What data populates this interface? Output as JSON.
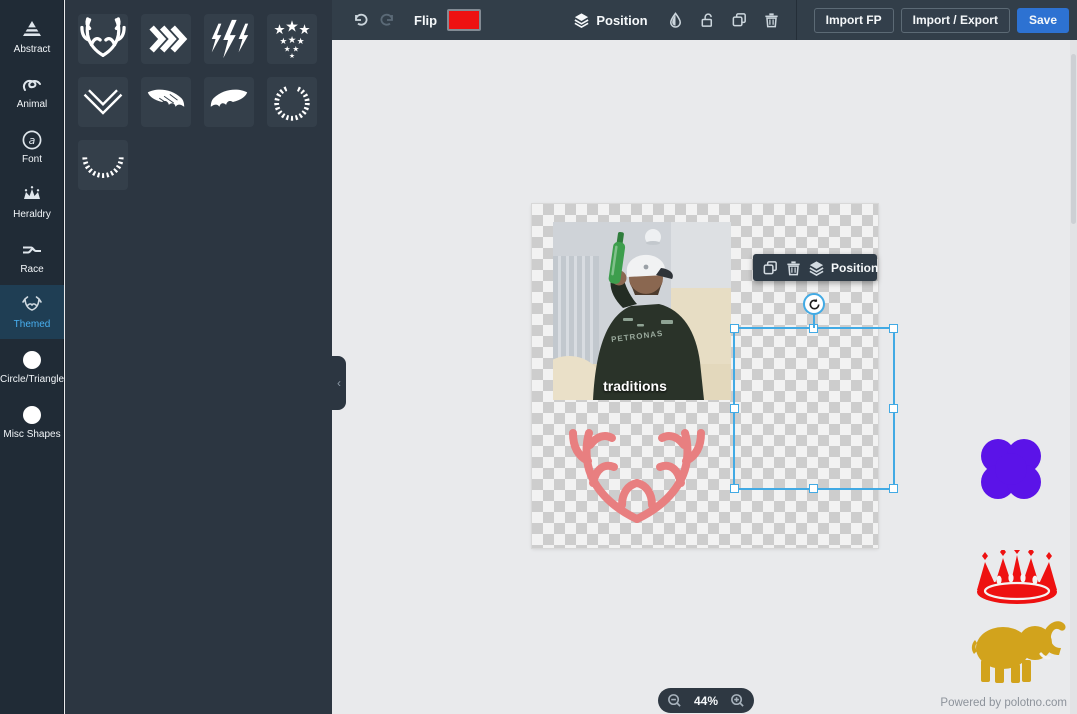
{
  "sidebar": {
    "items": [
      {
        "label": "Abstract",
        "icon": "abstract-icon",
        "active": false
      },
      {
        "label": "Animal",
        "icon": "animal-icon",
        "active": false
      },
      {
        "label": "Font",
        "icon": "font-icon",
        "active": false
      },
      {
        "label": "Heraldry",
        "icon": "heraldry-icon",
        "active": false
      },
      {
        "label": "Race",
        "icon": "race-icon",
        "active": false
      },
      {
        "label": "Themed",
        "icon": "antlers-icon",
        "active": true
      },
      {
        "label": "Circle/Triangle",
        "icon": "circle-icon",
        "active": false
      },
      {
        "label": "Misc Shapes",
        "icon": "circle-icon",
        "active": false
      }
    ]
  },
  "shapes_panel": {
    "tiles": [
      "antlers",
      "triple-chevron-right",
      "lightning-bolts",
      "stars-cluster",
      "chevron-down-outline",
      "wing-left",
      "wing-right",
      "laurel-wreath-circle",
      "laurel-wreath-semi"
    ]
  },
  "toolbar": {
    "flip_label": "Flip",
    "swatch_color": "#ee1111",
    "position_label": "Position",
    "import_fp_label": "Import FP",
    "import_export_label": "Import / Export",
    "save_label": "Save"
  },
  "floating_toolbar": {
    "position_label": "Position"
  },
  "canvas": {
    "zoom_level": "44%",
    "powered_by": "Powered by polotno.com",
    "photo_caption": "traditions",
    "jersey_text": "PETRONAS"
  },
  "colors": {
    "selection": "#42aae4",
    "save_button": "#2d72d2",
    "flower": "#5b13e8",
    "crown": "#ee1111",
    "elephant": "#d2a31c",
    "antlers": "#e87f80",
    "sidebar_active_text": "#48aff0"
  }
}
